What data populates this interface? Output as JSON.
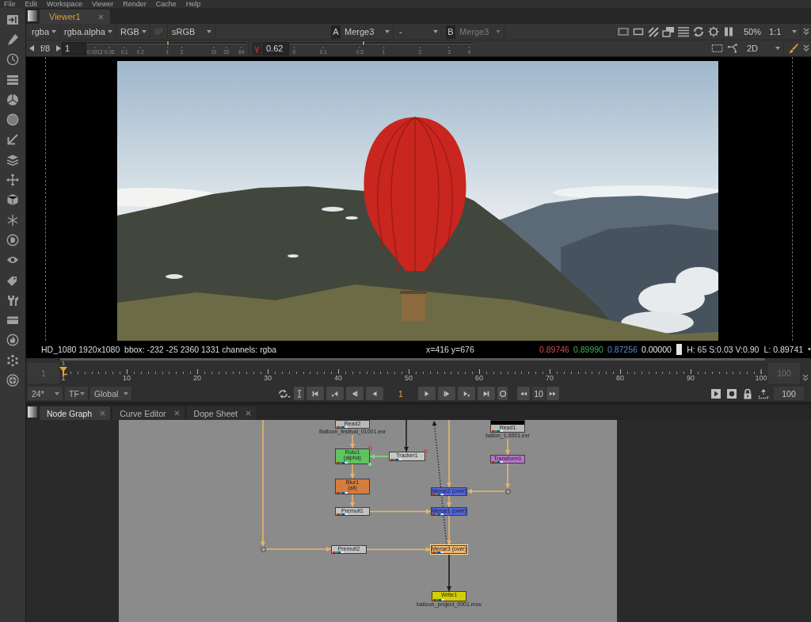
{
  "menu": [
    "File",
    "Edit",
    "Workspace",
    "Viewer",
    "Render",
    "Cache",
    "Help"
  ],
  "viewer": {
    "tabs": [
      {
        "label": "Viewer1",
        "selected": true
      }
    ],
    "toolbar": {
      "channels": "rgba",
      "alpha": "rgba.alpha",
      "display": "RGB",
      "ip": {
        "label": "IP",
        "on": false
      },
      "lut": "sRGB",
      "input_a": {
        "label": "A",
        "node": "Merge3",
        "active": true
      },
      "wipe": "-",
      "input_b": {
        "label": "B",
        "node": "Merge3",
        "active": false
      },
      "zoom": "50%",
      "proxy": "1:1",
      "view_mode": "2D"
    },
    "gain": {
      "label": "f/8",
      "value": "1",
      "level": 0.5,
      "ticks": [
        "0.0312",
        "0.05",
        "0.1",
        "0.2",
        "1",
        "2",
        "10",
        "20",
        "64"
      ]
    },
    "gamma": {
      "toggle": "γ",
      "value": "0.62",
      "level": 0.4,
      "ticks": [
        "0",
        "0.1",
        "0.5",
        "1",
        "2",
        "3",
        "4"
      ]
    },
    "info": {
      "format": "HD_1080 1920x1080  bbox: -232 -25 2360 1331 channels: rgba",
      "cursor": "x=416 y=676",
      "red": "0.89746",
      "green": "0.89990",
      "blue": "0.87256",
      "alpha": "0.00000",
      "hsv": "H: 65 S:0.03 V:0.90",
      "luma": "L: 0.89741"
    }
  },
  "timeline": {
    "range_start": "1",
    "range_end": "100",
    "playhead": {
      "label": "1",
      "level": 0
    },
    "ticks": [
      "1",
      "10",
      "20",
      "30",
      "40",
      "50",
      "60",
      "70",
      "80",
      "90",
      "100"
    ],
    "fps": "24*",
    "time_format": "TF",
    "range_mode": "Global",
    "frame": "1",
    "increment": "10",
    "out_frame": "100"
  },
  "node_graph": {
    "tabs": [
      {
        "label": "Node Graph",
        "selected": true
      },
      {
        "label": "Curve Editor",
        "selected": false
      },
      {
        "label": "Dope Sheet",
        "selected": false
      }
    ],
    "nodes": [
      {
        "kind": "read",
        "label": "Read2",
        "file": "Balloon_festival_01001.exr",
        "color": "#b9b9b9",
        "selected": false,
        "thumbnail": false,
        "indicator": false,
        "link_dot": false
      },
      {
        "kind": "read",
        "label": "Read1",
        "file": "ballon_1.0001.exr",
        "color": "#b9b9b9",
        "selected": false,
        "thumbnail": true,
        "indicator": false,
        "link_dot": false
      },
      {
        "kind": "roto",
        "label": "Roto1",
        "sub": "(alpha)",
        "color": "#5fc35f",
        "selected": false,
        "thumbnail": false,
        "indicator": true,
        "link_dot": true
      },
      {
        "kind": "tracker",
        "label": "Tracker1",
        "color": "#c6c6c6",
        "selected": false,
        "thumbnail": false,
        "indicator": true,
        "link_dot": false
      },
      {
        "kind": "transform",
        "label": "Transform1",
        "color": "#b676c8",
        "selected": false,
        "thumbnail": false,
        "indicator": false,
        "link_dot": false
      },
      {
        "kind": "blur",
        "label": "Blur1",
        "sub": "(all)",
        "color": "#d57d3f",
        "selected": false,
        "thumbnail": false,
        "indicator": false,
        "link_dot": false
      },
      {
        "kind": "merge",
        "label": "Merge2 (over)",
        "color": "#5466d6",
        "selected": false,
        "thumbnail": false,
        "indicator": false,
        "link_dot": false
      },
      {
        "kind": "dot"
      },
      {
        "kind": "premult",
        "label": "Premult1",
        "color": "#c3c3c3",
        "selected": false,
        "thumbnail": false,
        "indicator": false,
        "link_dot": false
      },
      {
        "kind": "merge",
        "label": "Merge1 (over)",
        "color": "#5466d6",
        "selected": false,
        "thumbnail": false,
        "indicator": false,
        "link_dot": false
      },
      {
        "kind": "dot"
      },
      {
        "kind": "premult",
        "label": "Premult2",
        "color": "#c3c3c3",
        "selected": false,
        "thumbnail": false,
        "indicator": false,
        "link_dot": false
      },
      {
        "kind": "merge",
        "label": "Merge3 (over)",
        "color": "#f2b768",
        "selected": true,
        "thumbnail": false,
        "indicator": false,
        "link_dot": false
      },
      {
        "kind": "write",
        "label": "Write1",
        "file": "balloon_project_0001.mov",
        "color": "#d3cf00",
        "selected": false,
        "thumbnail": false,
        "indicator": false,
        "link_dot": false
      }
    ]
  }
}
